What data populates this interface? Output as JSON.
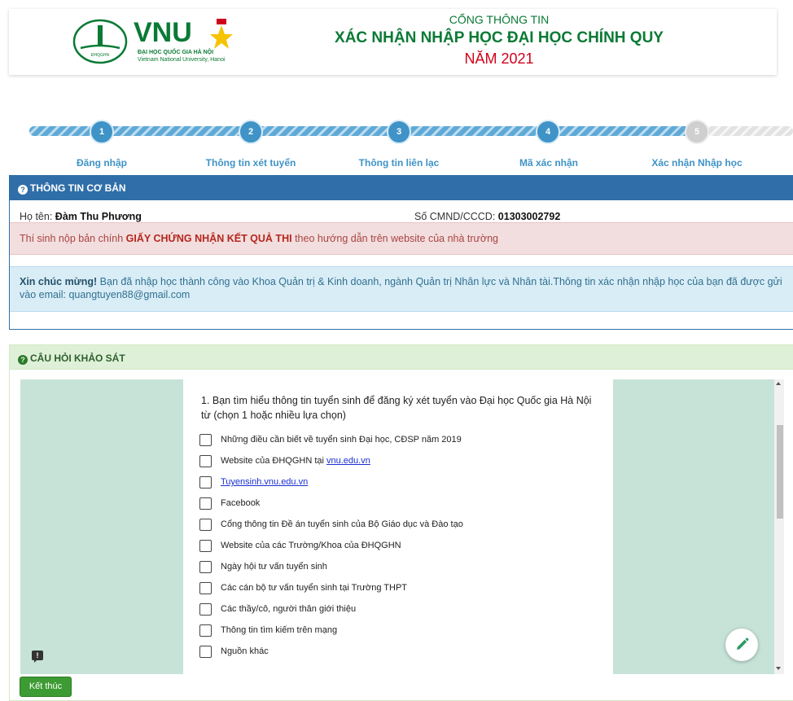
{
  "header": {
    "logo_text": "VNU",
    "logo_emblem_text": "ĐHQGHN",
    "logo_sub1": "ĐẠI HỌC QUỐC GIA HÀ NỘI",
    "logo_sub2": "Vietnam National University, Hanoi",
    "title_line1": "CỔNG THÔNG TIN",
    "title_line2": "XÁC NHẬN NHẬP HỌC ĐẠI HỌC CHÍNH QUY",
    "title_line3": "NĂM 2021",
    "colors": {
      "brand_green": "#0a7a35",
      "year_red": "#d0021b"
    }
  },
  "stepper": {
    "steps": [
      {
        "number": "1",
        "label": "Đăng nhập",
        "state": "done"
      },
      {
        "number": "2",
        "label": "Thông tin xét tuyển",
        "state": "done"
      },
      {
        "number": "3",
        "label": "Thông tin liên lạc",
        "state": "done"
      },
      {
        "number": "4",
        "label": "Mã xác nhận",
        "state": "done"
      },
      {
        "number": "5",
        "label": "Xác nhận Nhập học",
        "state": "current"
      }
    ]
  },
  "basic_info": {
    "heading": "THÔNG TIN CƠ BẢN",
    "name_label": "Họ tên:",
    "name_value": "Đàm Thu Phương",
    "id_label": "Số CMND/CCCD:",
    "id_value": "01303002792",
    "alert_red_prefix": "Thí sinh nộp bản chính",
    "alert_red_bold": "GIẤY CHỨNG NHẬN KẾT QUẢ THI",
    "alert_red_suffix": "theo hướng dẫn trên website của nhà trường",
    "alert_blue_bold": "Xin chúc mừng!",
    "alert_blue_text": "Bạn đã nhập học thành công vào Khoa Quản trị & Kinh doanh, ngành Quản trị Nhân lực và Nhân tài.Thông tin xác nhận nhập học của bạn đã được gửi vào email: quangtuyen88@gmail.com"
  },
  "survey": {
    "heading": "CÂU HỎI KHẢO SÁT",
    "question": "1. Bạn tìm hiểu thông tin tuyển sinh để đăng ký xét tuyển vào Đại học Quốc gia Hà Nội từ (chọn 1 hoặc nhiều lựa chọn)",
    "options": [
      {
        "text": "Những điều cần biết về tuyển sinh Đại học, CĐSP năm 2019",
        "link": ""
      },
      {
        "text": "Website của ĐHQGHN tại ",
        "link": "vnu.edu.vn"
      },
      {
        "text": "",
        "link": "Tuyensinh.vnu.edu.vn"
      },
      {
        "text": "Facebook",
        "link": ""
      },
      {
        "text": "Cổng thông tin Đề án tuyển sinh của Bộ Giáo dục và Đào tạo",
        "link": ""
      },
      {
        "text": "Website của các Trường/Khoa của ĐHQGHN",
        "link": ""
      },
      {
        "text": "Ngày hội tư vấn tuyển sinh",
        "link": ""
      },
      {
        "text": "Các cán bộ tư vấn tuyển sinh tại Trường THPT",
        "link": ""
      },
      {
        "text": "Các thầy/cô, người thân giới thiệu",
        "link": ""
      },
      {
        "text": "Thông tin tìm kiếm trên mạng",
        "link": ""
      },
      {
        "text": "Nguồn khác",
        "link": ""
      }
    ],
    "finish_label": "Kết thúc"
  }
}
